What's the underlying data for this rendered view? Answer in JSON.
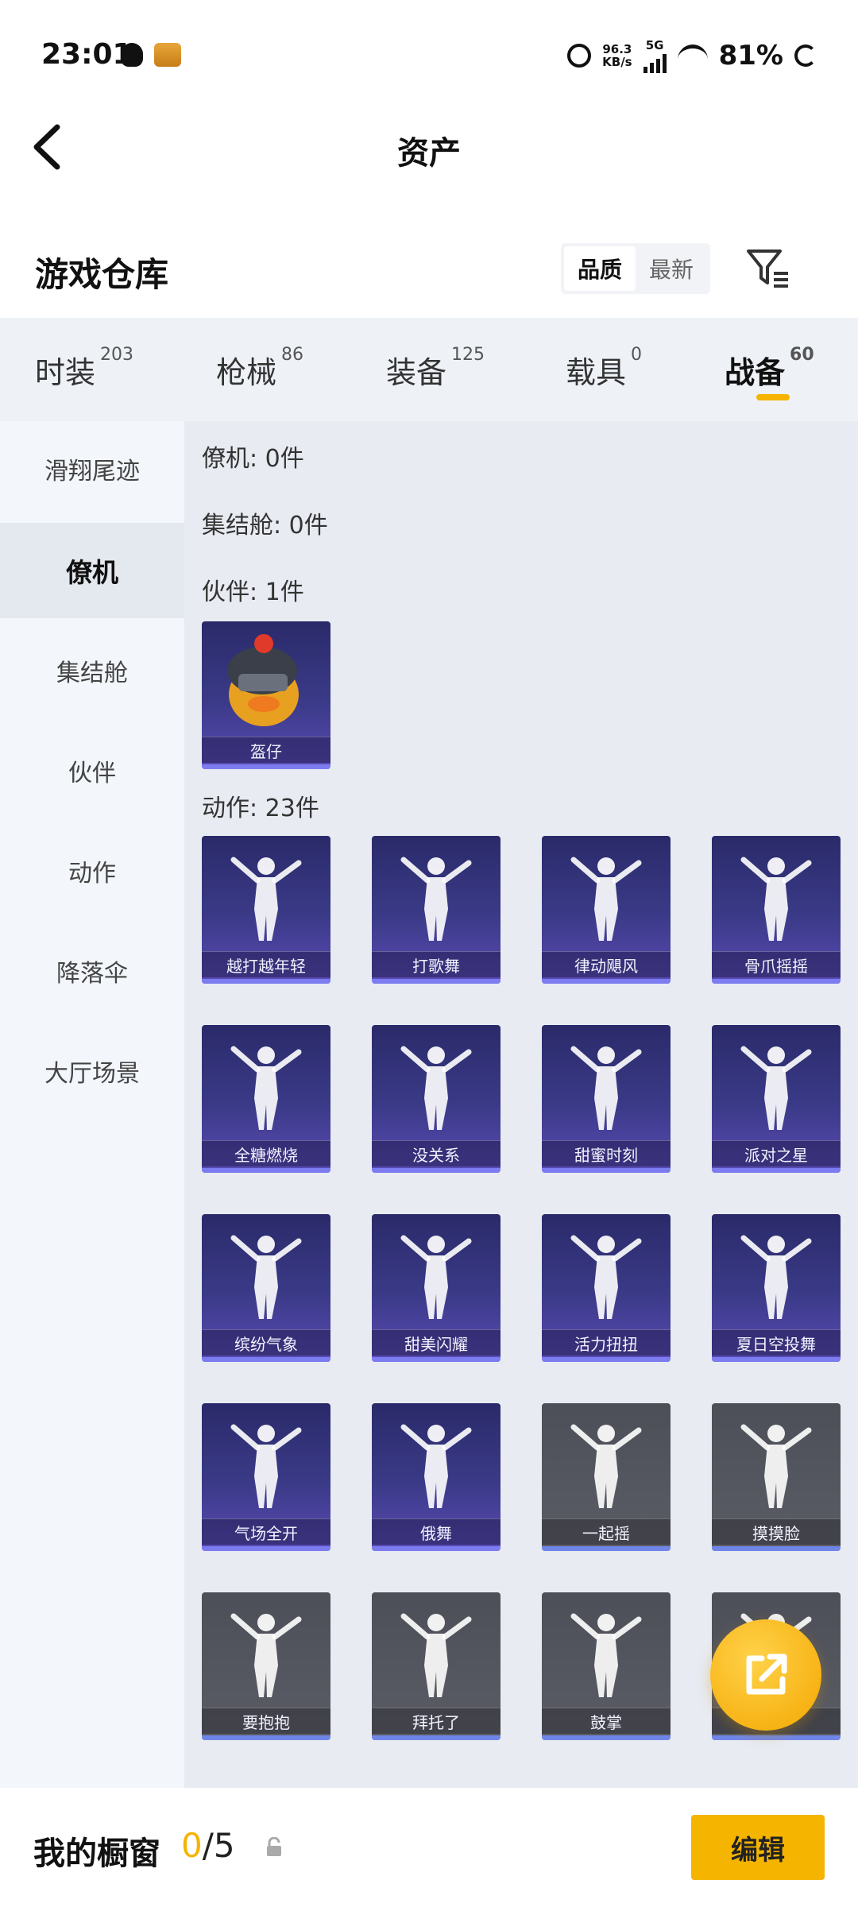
{
  "status_bar": {
    "time": "23:01",
    "speed_top": "96.3",
    "speed_unit": "KB/s",
    "network": "5G",
    "battery": "81%"
  },
  "header": {
    "title": "资产",
    "back_icon": "chevron-left-icon"
  },
  "warehouse": {
    "title": "游戏仓库",
    "sort_options": [
      "品质",
      "最新"
    ],
    "sort_selected": "品质",
    "filter_icon": "filter-icon"
  },
  "tabs": [
    {
      "label": "时装",
      "count": "203"
    },
    {
      "label": "枪械",
      "count": "86"
    },
    {
      "label": "装备",
      "count": "125"
    },
    {
      "label": "载具",
      "count": "0"
    },
    {
      "label": "战备",
      "count": "60"
    }
  ],
  "active_tab": "战备",
  "sidebar": {
    "items": [
      "滑翔尾迹",
      "僚机",
      "集结舱",
      "伙伴",
      "动作",
      "降落伞",
      "大厅场景"
    ],
    "selected": "僚机"
  },
  "sections": {
    "wingman": "僚机: 0件",
    "rally_pod": "集结舱: 0件",
    "partner": "伙伴: 1件",
    "emote": "动作: 23件"
  },
  "partner_items": [
    {
      "name": "盔仔",
      "style": "purple"
    }
  ],
  "emote_items": [
    {
      "name": "越打越年轻",
      "style": "purple"
    },
    {
      "name": "打歌舞",
      "style": "purple"
    },
    {
      "name": "律动飓风",
      "style": "purple"
    },
    {
      "name": "骨爪摇摇",
      "style": "purple"
    },
    {
      "name": "全糖燃烧",
      "style": "purple"
    },
    {
      "name": "没关系",
      "style": "purple"
    },
    {
      "name": "甜蜜时刻",
      "style": "purple"
    },
    {
      "name": "派对之星",
      "style": "purple"
    },
    {
      "name": "缤纷气象",
      "style": "purple"
    },
    {
      "name": "甜美闪耀",
      "style": "purple"
    },
    {
      "name": "活力扭扭",
      "style": "purple"
    },
    {
      "name": "夏日空投舞",
      "style": "purple"
    },
    {
      "name": "气场全开",
      "style": "purple"
    },
    {
      "name": "俄舞",
      "style": "purple"
    },
    {
      "name": "一起摇",
      "style": "gray"
    },
    {
      "name": "摸摸脸",
      "style": "gray"
    },
    {
      "name": "要抱抱",
      "style": "gray"
    },
    {
      "name": "拜托了",
      "style": "gray"
    },
    {
      "name": "鼓掌",
      "style": "gray"
    },
    {
      "name": "",
      "style": "gray"
    }
  ],
  "bottom": {
    "showcase_label": "我的橱窗",
    "showcase_current": "0",
    "showcase_total": "/5",
    "edit_label": "编辑"
  },
  "colors": {
    "accent": "#f5b400",
    "card_purple": "#3b3a88",
    "card_gray": "#5b5d66",
    "sidebar_bg": "#f3f7fc",
    "content_bg": "#e8ebf2"
  }
}
